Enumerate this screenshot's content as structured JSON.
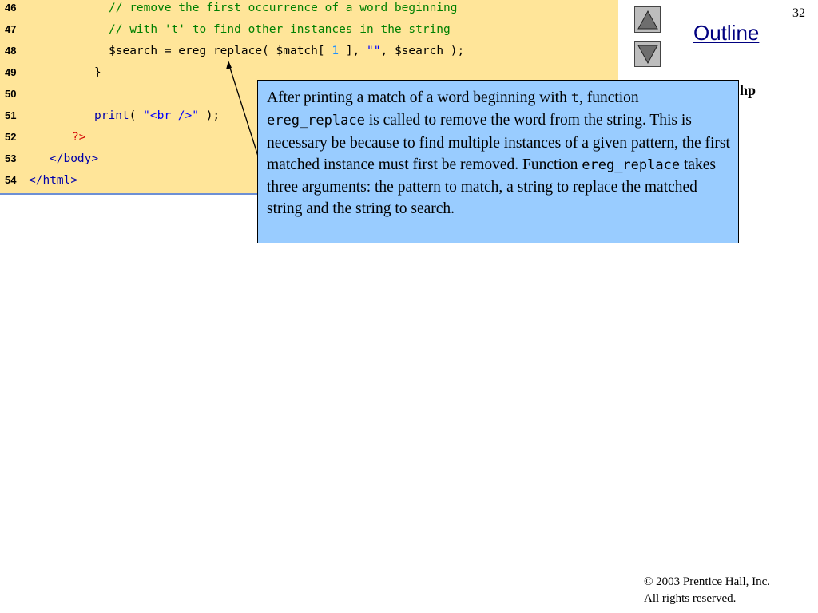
{
  "slide": {
    "page_number": "32"
  },
  "code": {
    "lines": [
      {
        "num": "46",
        "parts": [
          {
            "text": "// remove the first occurrence of a word beginning",
            "style": "cm"
          }
        ]
      },
      {
        "num": "47",
        "parts": [
          {
            "text": "// with 't' to find other instances in the string",
            "style": "cm"
          }
        ]
      },
      {
        "num": "48",
        "parts": [
          {
            "text": "$search = ereg_replace( $match[ ",
            "style": "blk"
          },
          {
            "text": "1",
            "style": "num"
          },
          {
            "text": " ], ",
            "style": "blk"
          },
          {
            "text": "\"\"",
            "style": "str"
          },
          {
            "text": ", $search );",
            "style": "blk"
          }
        ]
      },
      {
        "num": "49",
        "parts": [
          {
            "text": "}",
            "style": "blk"
          }
        ]
      },
      {
        "num": "50",
        "parts": []
      },
      {
        "num": "51",
        "parts": [
          {
            "text": "print",
            "style": "kw"
          },
          {
            "text": "( ",
            "style": "blk"
          },
          {
            "text": "\"<br />\"",
            "style": "str"
          },
          {
            "text": " );",
            "style": "blk"
          }
        ]
      },
      {
        "num": "52",
        "parts": [
          {
            "text": "?>",
            "style": "php"
          }
        ]
      },
      {
        "num": "53",
        "parts": [
          {
            "text": "</body>",
            "style": "kw"
          }
        ]
      },
      {
        "num": "54",
        "parts": [
          {
            "text": "</html>",
            "style": "kw"
          }
        ]
      }
    ]
  },
  "nav": {
    "outline_label": "Outline",
    "file_fragment": "hp",
    "up_icon": "triangle-up-icon",
    "down_icon": "triangle-down-icon"
  },
  "callout": {
    "segments": [
      {
        "text": "After printing a match of a word beginning with ",
        "mono": false
      },
      {
        "text": "t",
        "mono": true
      },
      {
        "text": ", function ",
        "mono": false
      },
      {
        "text": "ereg_replace",
        "mono": true
      },
      {
        "text": " is called to remove the word from the string. This is necessary be because to find multiple instances of a given pattern, the first matched instance must first be removed. Function ",
        "mono": false
      },
      {
        "text": "ereg_replace",
        "mono": true
      },
      {
        "text": " takes three arguments: the pattern to match, a string to replace the matched string and the string to search.",
        "mono": false
      }
    ]
  },
  "footer": {
    "copyright_symbol": "©",
    "copyright": " 2003 Prentice Hall, Inc.",
    "rights": "All rights reserved."
  },
  "colors": {
    "code_background": "#ffe599",
    "callout_background": "#99ccff",
    "outline_link": "#000080"
  }
}
